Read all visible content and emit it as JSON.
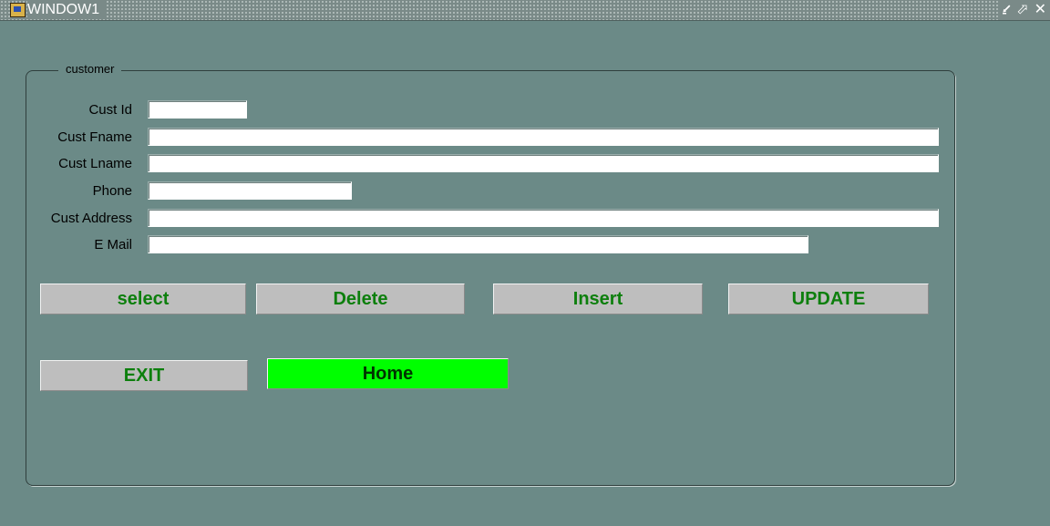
{
  "window": {
    "title": "WINDOW1",
    "controls": {
      "minimize": "⭹",
      "maximize": "⬀",
      "close": "✕"
    }
  },
  "frame": {
    "label": "customer"
  },
  "fields": {
    "cust_id": {
      "label": "Cust Id",
      "value": ""
    },
    "cust_fname": {
      "label": "Cust Fname",
      "value": ""
    },
    "cust_lname": {
      "label": "Cust Lname",
      "value": ""
    },
    "phone": {
      "label": "Phone",
      "value": ""
    },
    "cust_address": {
      "label": "Cust Address",
      "value": ""
    },
    "email": {
      "label": "E Mail",
      "value": ""
    }
  },
  "buttons": {
    "select": "select",
    "delete": "Delete",
    "insert": "Insert",
    "update": "UPDATE",
    "exit": "EXIT",
    "home": "Home"
  },
  "colors": {
    "background": "#6b8a87",
    "button": "#bebebe",
    "button_text": "#0d7f0d",
    "home_button": "#00ff00"
  }
}
